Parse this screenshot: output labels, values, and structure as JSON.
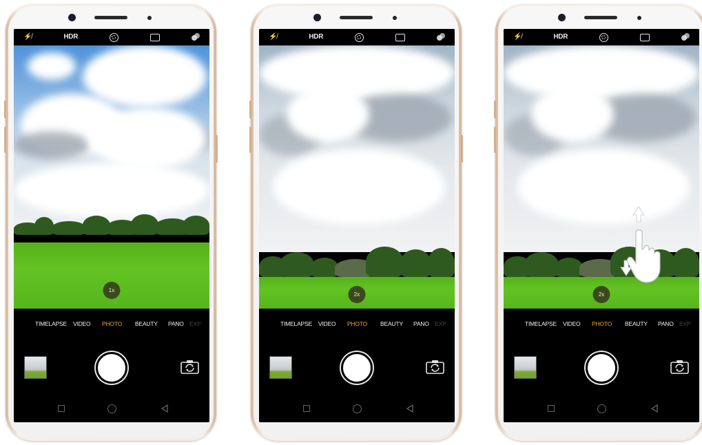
{
  "phones": [
    {
      "zoom_label": "1x",
      "modes": [
        "TIMELAPSE",
        "VIDEO",
        "PHOTO",
        "BEAUTY",
        "PANO",
        "EXP"
      ],
      "active_mode": "PHOTO",
      "gesture": false
    },
    {
      "zoom_label": "2x",
      "modes": [
        "TIMELAPSE",
        "VIDEO",
        "PHOTO",
        "BEAUTY",
        "PANO",
        "EXP"
      ],
      "active_mode": "PHOTO",
      "gesture": false
    },
    {
      "zoom_label": "2x",
      "modes": [
        "TIMELAPSE",
        "VIDEO",
        "PHOTO",
        "BEAUTY",
        "PANO",
        "EXP"
      ],
      "active_mode": "PHOTO",
      "gesture": true
    }
  ],
  "topbar": {
    "flash_icon": "flash-off-icon",
    "hdr_label": "HDR",
    "aperture_icon": "aperture-icon",
    "ratio_icon": "aspect-ratio-icon",
    "filter_icon": "filter-icon"
  },
  "controls": {
    "thumbnail_icon": "gallery-thumbnail",
    "shutter_icon": "shutter-button",
    "switch_icon": "switch-camera-icon"
  },
  "navbar": {
    "recent_icon": "recent-apps-icon",
    "home_icon": "home-icon",
    "back_icon": "back-icon"
  },
  "colors": {
    "active_mode": "#e8a827",
    "grass": "#5dbd20",
    "zoom_badge": "#3b4a1c",
    "phone_frame": "#f3ece5"
  }
}
